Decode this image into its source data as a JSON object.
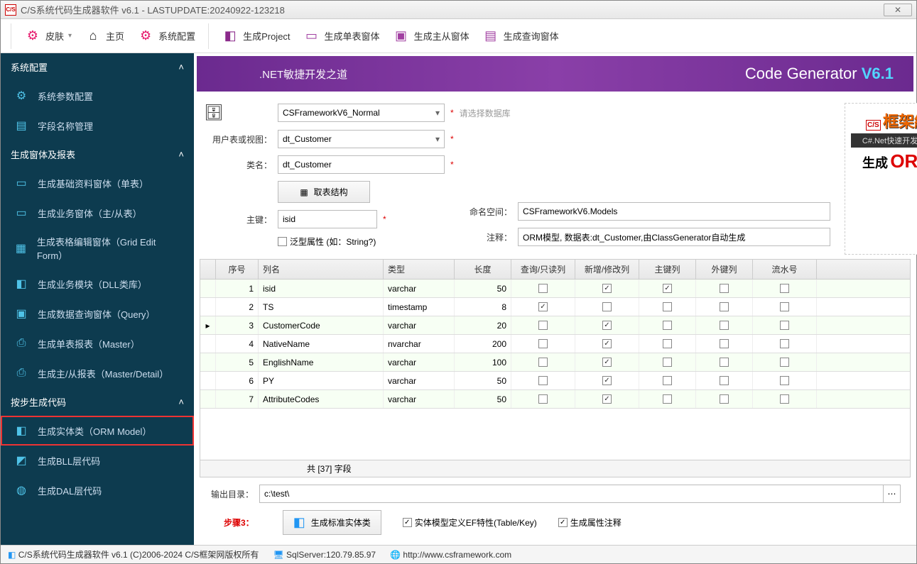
{
  "window": {
    "title": "C/S系统代码生成器软件 v6.1 - LASTUPDATE:20240922-123218",
    "icon_text": "C/S"
  },
  "toolbar": {
    "skin": "皮肤",
    "home": "主页",
    "config": "系统配置",
    "gen_project": "生成Project",
    "gen_single": "生成单表窗体",
    "gen_master": "生成主从窗体",
    "gen_query": "生成查询窗体"
  },
  "sidebar": {
    "sections": {
      "s1": {
        "title": "系统配置",
        "items": [
          "系统参数配置",
          "字段名称管理"
        ]
      },
      "s2": {
        "title": "生成窗体及报表",
        "items": [
          "生成基础资料窗体（单表）",
          "生成业务窗体（主/从表）",
          "生成表格编辑窗体（Grid Edit Form）",
          "生成业务模块（DLL类库）",
          "生成数据查询窗体（Query）",
          "生成单表报表（Master）",
          "生成主/从报表（Master/Detail）"
        ]
      },
      "s3": {
        "title": "按步生成代码",
        "items": [
          "生成实体类（ORM Model）",
          "生成BLL层代码",
          "生成DAL层代码"
        ]
      }
    }
  },
  "banner": {
    "left": ".NET敏捷开发之道",
    "right_a": "Code Generator ",
    "right_b": "V6.1"
  },
  "form": {
    "db_value": "CSFrameworkV6_Normal",
    "db_hint": "请选择数据库",
    "table_lbl": "用户表或视图：",
    "table_val": "dt_Customer",
    "class_lbl": "类名：",
    "class_val": "dt_Customer",
    "getstruct": "取表结构",
    "pk_lbl": "主键：",
    "pk_val": "isid",
    "generic_lbl": "泛型属性 (如：String?)",
    "ns_lbl": "命名空间：",
    "ns_val": "CSFrameworkV6.Models",
    "comment_lbl": "注释：",
    "comment_val": "ORM模型, 数据表:dt_Customer,由ClassGenerator自动生成"
  },
  "grid": {
    "headers": [
      "",
      "序号",
      "列名",
      "类型",
      "长度",
      "查询/只读列",
      "新增/修改列",
      "主键列",
      "外键列",
      "流水号"
    ],
    "rows": [
      {
        "n": "1",
        "name": "isid",
        "type": "varchar",
        "len": "50",
        "q": false,
        "e": true,
        "pk": true,
        "fk": false,
        "sn": false
      },
      {
        "n": "2",
        "name": "TS",
        "type": "timestamp",
        "len": "8",
        "q": true,
        "e": false,
        "pk": false,
        "fk": false,
        "sn": false
      },
      {
        "n": "3",
        "name": "CustomerCode",
        "type": "varchar",
        "len": "20",
        "q": false,
        "e": true,
        "pk": false,
        "fk": false,
        "sn": false,
        "sel": true
      },
      {
        "n": "4",
        "name": "NativeName",
        "type": "nvarchar",
        "len": "200",
        "q": false,
        "e": true,
        "pk": false,
        "fk": false,
        "sn": false
      },
      {
        "n": "5",
        "name": "EnglishName",
        "type": "varchar",
        "len": "100",
        "q": false,
        "e": true,
        "pk": false,
        "fk": false,
        "sn": false
      },
      {
        "n": "6",
        "name": "PY",
        "type": "varchar",
        "len": "50",
        "q": false,
        "e": true,
        "pk": false,
        "fk": false,
        "sn": false
      },
      {
        "n": "7",
        "name": "AttributeCodes",
        "type": "varchar",
        "len": "50",
        "q": false,
        "e": true,
        "pk": false,
        "fk": false,
        "sn": false
      }
    ],
    "footer": "共 [37] 字段"
  },
  "bottom": {
    "out_lbl": "输出目录：",
    "out_val": "c:\\test\\",
    "step3": "步骤3：",
    "gen_btn": "生成标准实体类",
    "chk1": "实体模型定义EF特性(Table/Key)",
    "chk2": "生成属性注释"
  },
  "status": {
    "app": "C/S系统代码生成器软件 v6.1 (C)2006-2024 C/S框架网版权所有",
    "db": "SqlServer:120.79.85.97",
    "url": "http://www.csframework.com"
  },
  "promo": {
    "l1": "C/S",
    "l2": "框架網",
    "l3": "C#.Net快速开发平台",
    "l4": "生成",
    "l5": "ORM"
  }
}
